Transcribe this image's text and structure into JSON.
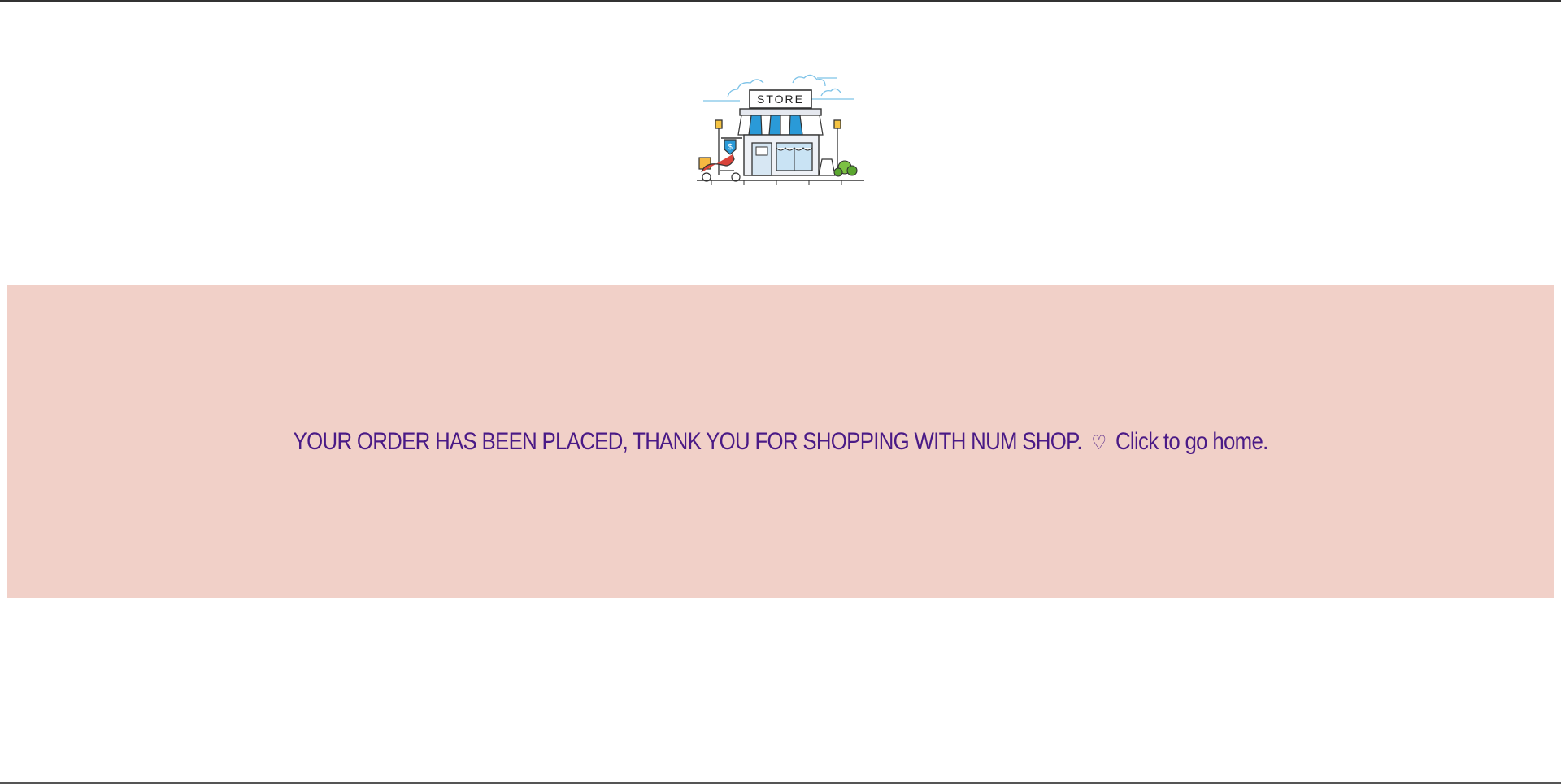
{
  "logo": {
    "sign_text": "STORE",
    "price_tag": "$",
    "icon_name": "storefront-icon"
  },
  "banner": {
    "message": "YOUR ORDER HAS BEEN PLACED, THANK YOU FOR SHOPPING WITH NUM SHOP.",
    "heart": "♡",
    "home_link": "Click to go home."
  },
  "colors": {
    "banner_bg": "#f1d0c8",
    "text": "#4a1a86",
    "awning_blue": "#2a9ad8",
    "scooter_red": "#d9433a"
  }
}
